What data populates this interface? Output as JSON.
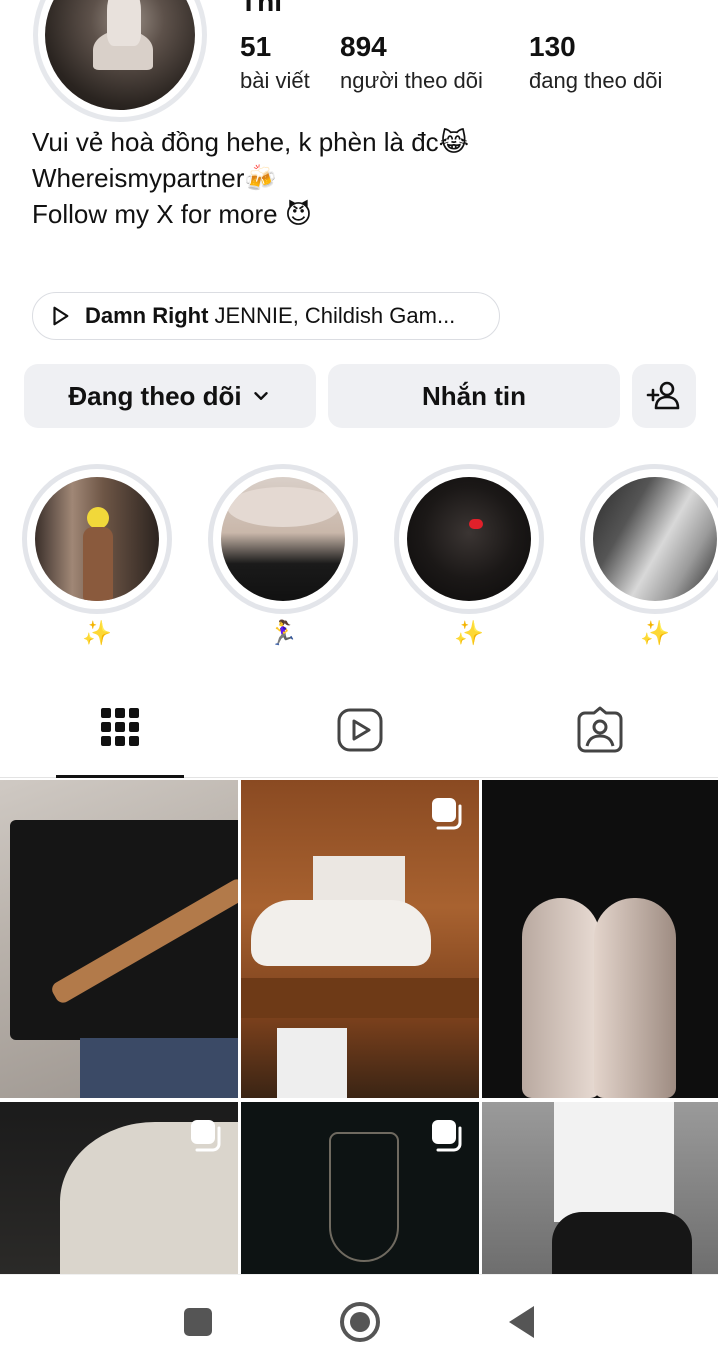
{
  "profile": {
    "name_partial": "Thi",
    "stats": [
      {
        "value": "51",
        "label": "bài viết"
      },
      {
        "value": "894",
        "label": "người theo dõi"
      },
      {
        "value": "130",
        "label": "đang theo dõi"
      }
    ],
    "bio_lines": [
      "Vui vẻ hoà đồng hehe, k phèn là đc😹",
      "Whereismypartner🍻",
      "Follow my X for more 😈"
    ],
    "music": {
      "song": "Damn Right",
      "artists": "JENNIE, Childish Gam..."
    }
  },
  "actions": {
    "following_label": "Đang theo dõi",
    "message_label": "Nhắn tin",
    "add_person_icon": "add-person-icon"
  },
  "highlights": [
    {
      "caption": "✨"
    },
    {
      "caption": "🏃‍♀️"
    },
    {
      "caption": "✨"
    },
    {
      "caption": "✨"
    }
  ],
  "tabs": [
    {
      "icon": "grid-icon",
      "active": true
    },
    {
      "icon": "reels-icon",
      "active": false
    },
    {
      "icon": "tagged-icon",
      "active": false
    }
  ],
  "posts": [
    {
      "alt": "shirt on hanger",
      "multi": false
    },
    {
      "alt": "white toy car",
      "multi": true
    },
    {
      "alt": "legs in car",
      "multi": false
    },
    {
      "alt": "white shirt",
      "multi": true
    },
    {
      "alt": "wine glass",
      "multi": true
    },
    {
      "alt": "pants and sneaker",
      "multi": false
    }
  ],
  "colors": {
    "button_bg": "#eff0f3",
    "ring": "#e3e5ea",
    "text": "#111111"
  }
}
